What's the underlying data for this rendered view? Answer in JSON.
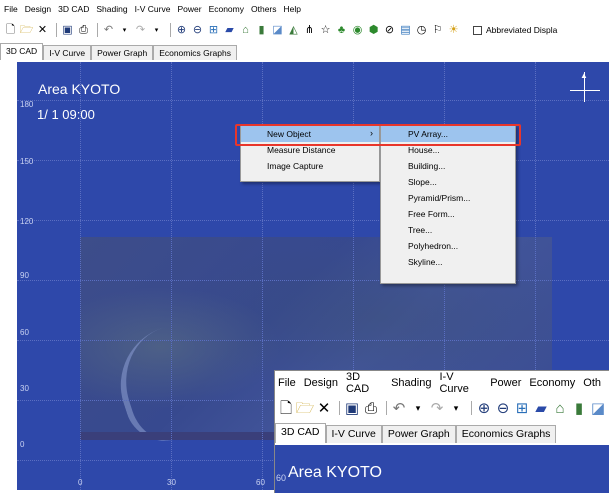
{
  "menu": [
    "File",
    "Design",
    "3D CAD",
    "Shading",
    "I-V Curve",
    "Power",
    "Economy",
    "Others",
    "Help"
  ],
  "toolbar": {
    "icons": [
      "new-file-icon",
      "open-folder-icon",
      "close-icon",
      "save-icon",
      "print-icon",
      "undo-icon",
      "redo-icon",
      "zoom-in-icon",
      "zoom-out-icon",
      "fit-view-icon",
      "pv-array-icon",
      "house-icon",
      "building-icon",
      "slope-icon",
      "pyramid-icon",
      "free-form-icon",
      "star-icon",
      "tree-icon",
      "sphere-icon",
      "polyhedron-icon",
      "skyline-icon",
      "compass-icon",
      "shading-tool-icon",
      "sun-path-icon"
    ],
    "abbreviated_label": "Abbreviated Displa"
  },
  "tabs": [
    "3D CAD",
    "I-V Curve",
    "Power Graph",
    "Economics Graphs"
  ],
  "viewport": {
    "area_title": "Area KYOTO",
    "datetime": "1/ 1 09:00",
    "y_ticks": [
      "180",
      "150",
      "120",
      "90",
      "60",
      "30",
      "0"
    ],
    "x_ticks": [
      "0",
      "30",
      "60"
    ],
    "compass_north": "N"
  },
  "context_menu": {
    "items": [
      "New Object",
      "Measure Distance",
      "Image Capture"
    ],
    "highlighted": "New Object"
  },
  "submenu": {
    "items": [
      "PV Array...",
      "House...",
      "Building...",
      "Slope...",
      "Pyramid/Prism...",
      "Free Form...",
      "Tree...",
      "Polyhedron...",
      "Skyline..."
    ],
    "highlighted": "PV Array..."
  },
  "inset": {
    "menu": [
      "File",
      "Design",
      "3D CAD",
      "Shading",
      "I-V Curve",
      "Power",
      "Economy",
      "Oth"
    ],
    "tabs": [
      "3D CAD",
      "I-V Curve",
      "Power Graph",
      "Economics Graphs"
    ],
    "area_title": "Area KYOTO",
    "y_tick": "60"
  },
  "colors": {
    "viewport_bg": "#2e48aa",
    "highlight": "#9dc4ee",
    "callout_red": "#e8362b"
  }
}
